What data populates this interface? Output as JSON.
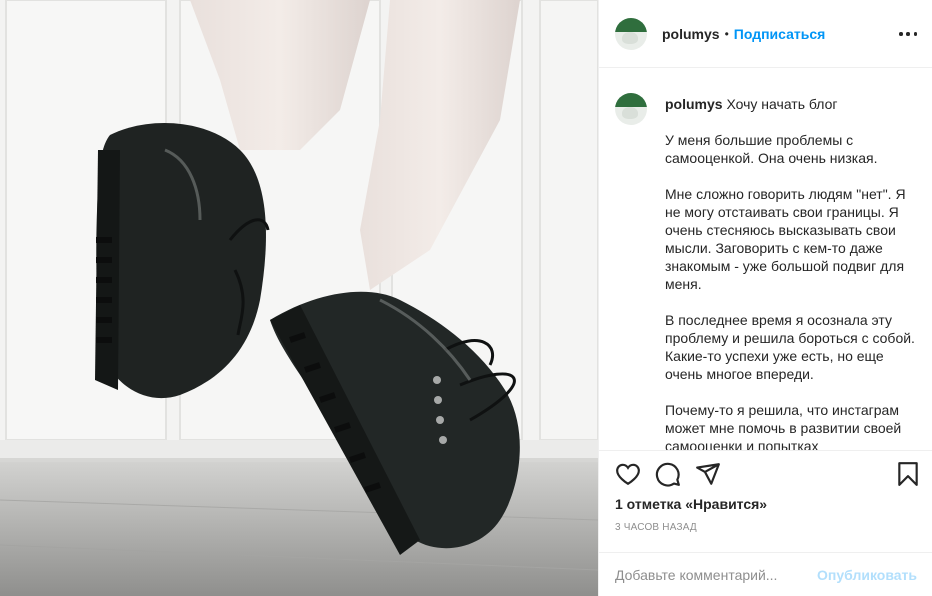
{
  "post": {
    "photo_alt": "",
    "author": {
      "username": "polumys",
      "follow_label": "Подписаться",
      "separator": "•"
    },
    "more_icon": "more-horizontal-icon",
    "caption": {
      "username": "polumys",
      "first_line": "Хочу начать блог",
      "paragraphs": [
        "У меня большие проблемы с самооценкой. Она очень низкая.",
        "Мне сложно говорить людям \"нет\". Я не могу отстаивать свои границы. Я очень стесняюсь высказывать свои мысли. Заговорить с кем-то даже знакомым - уже большой подвиг для меня.",
        "В последнее время я осознала эту проблему и решила бороться с собой. Какие-то успехи уже есть, но еще очень многое впереди.",
        "Почему-то я решила, что инстаграм может мне помочь в развитии своей самооценки и попытках"
      ]
    },
    "actions": {
      "icons": [
        "heart-icon",
        "comment-icon",
        "share-icon",
        "bookmark-icon"
      ]
    },
    "likes_text": "1 отметка «Нравится»",
    "time_ago": "3 часов назад",
    "comment": {
      "placeholder": "Добавьте комментарий...",
      "value": "",
      "publish_label": "Опубликовать"
    },
    "colors": {
      "accent": "#0095f6",
      "publish_disabled": "#b2dffc",
      "text": "#262626",
      "muted": "#8e8e8e",
      "border": "#efefef"
    }
  }
}
